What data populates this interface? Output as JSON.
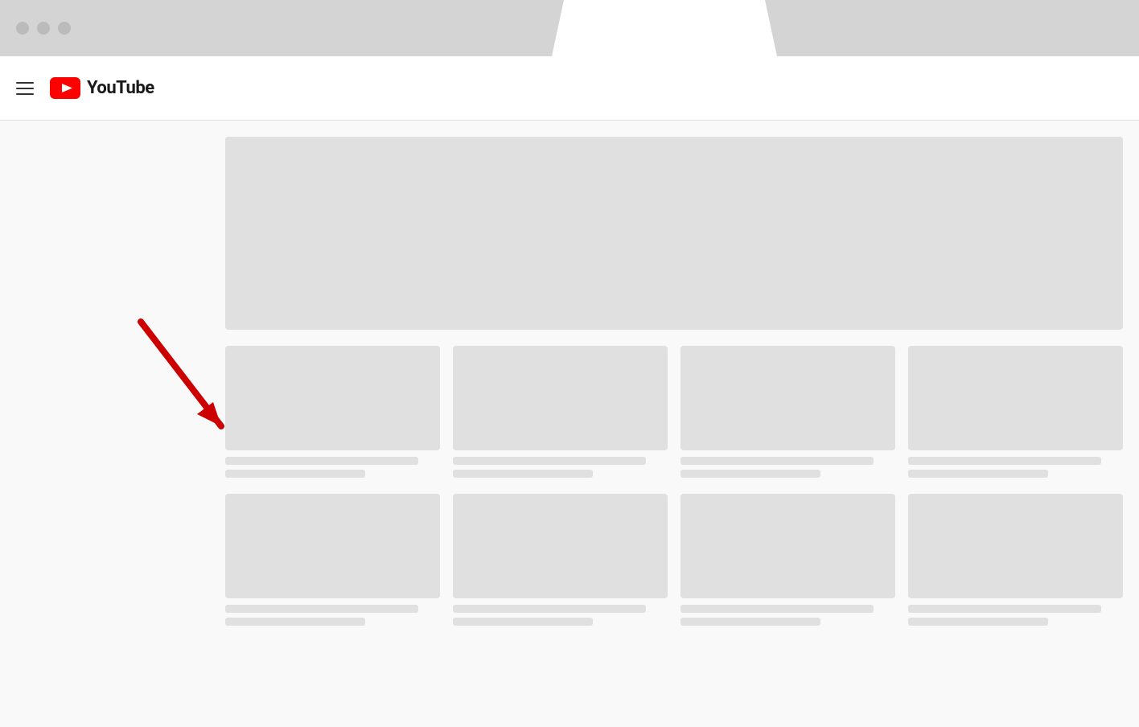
{
  "browser": {
    "traffic_lights": [
      "gray",
      "gray",
      "gray"
    ]
  },
  "header": {
    "logo_text": "YouTube",
    "hamburger_label": "Menu"
  },
  "content": {
    "hero_alt": "Hero banner placeholder",
    "video_grid_rows": [
      [
        {
          "title_width": "90%",
          "subtitle_width": "60%"
        },
        {
          "title_width": "88%",
          "subtitle_width": "65%"
        },
        {
          "title_width": "85%",
          "subtitle_width": "70%"
        },
        {
          "title_width": "92%",
          "subtitle_width": "55%"
        }
      ],
      [
        {
          "title_width": "90%",
          "subtitle_width": "60%"
        },
        {
          "title_width": "88%",
          "subtitle_width": "65%"
        },
        {
          "title_width": "85%",
          "subtitle_width": "70%"
        },
        {
          "title_width": "92%",
          "subtitle_width": "55%"
        }
      ]
    ]
  },
  "arrow": {
    "color": "#cc0000"
  }
}
